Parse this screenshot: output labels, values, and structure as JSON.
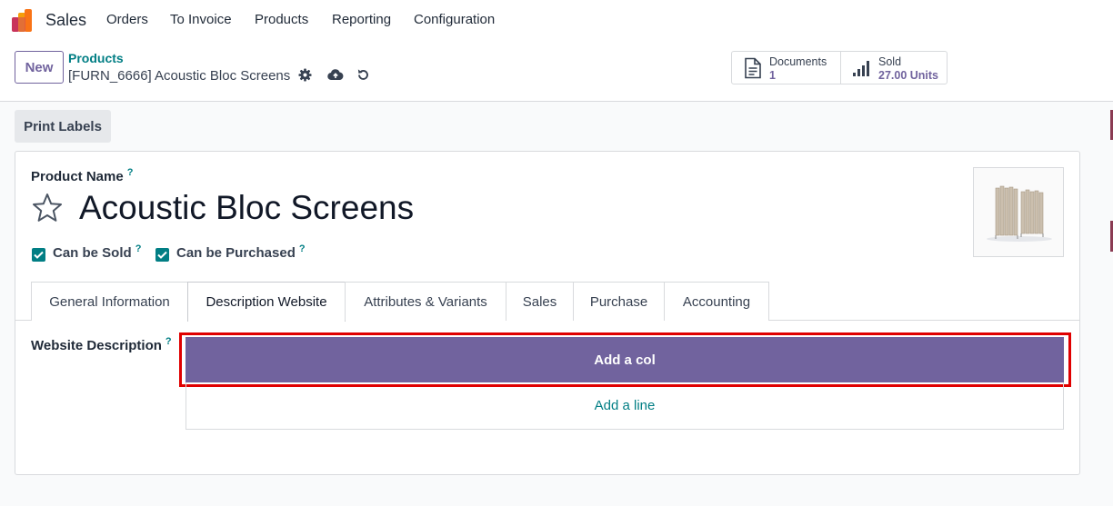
{
  "navbar": {
    "app_name": "Sales",
    "menu": [
      "Orders",
      "To Invoice",
      "Products",
      "Reporting",
      "Configuration"
    ]
  },
  "control_panel": {
    "new_label": "New",
    "breadcrumb_parent": "Products",
    "breadcrumb_current": "[FURN_6666] Acoustic Bloc Screens",
    "icons": [
      "gear-icon",
      "cloud-upload-icon",
      "discard-icon"
    ],
    "stats": {
      "documents": {
        "label": "Documents",
        "value": "1",
        "icon": "document-icon"
      },
      "sold": {
        "label": "Sold",
        "value": "27.00 Units",
        "icon": "bar-chart-icon"
      }
    }
  },
  "action_bar": {
    "print_labels": "Print Labels"
  },
  "form": {
    "product_name_label": "Product Name",
    "product_name": "Acoustic Bloc Screens",
    "favorite_icon": "star-icon",
    "help_mark": "?",
    "can_be_sold": {
      "label": "Can be Sold",
      "checked": true
    },
    "can_be_purchased": {
      "label": "Can be Purchased",
      "checked": true
    },
    "tabs": [
      "General Information",
      "Description Website",
      "Attributes & Variants",
      "Sales",
      "Purchase",
      "Accounting"
    ],
    "active_tab": "Description Website",
    "website_description_label": "Website Description",
    "add_col": "Add a col",
    "add_line": "Add a line"
  },
  "colors": {
    "primary": "#71639e",
    "link": "#017e84",
    "highlight": "#e00000",
    "checkbox": "#017e84"
  }
}
